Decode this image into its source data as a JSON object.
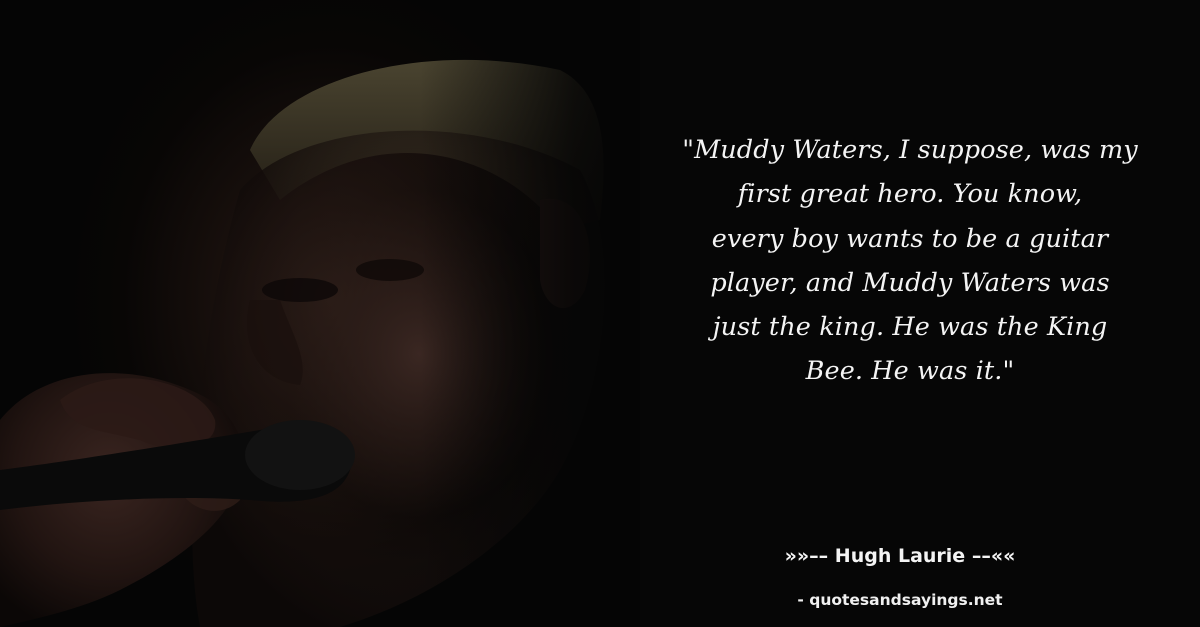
{
  "quote": {
    "lines": [
      "\"Muddy Waters, I suppose, was my",
      "first great hero. You know,",
      "every boy wants to be a guitar",
      "player, and Muddy Waters was",
      "just the king. He was the King",
      "Bee. He was it.\""
    ]
  },
  "attribution": {
    "left_ornament": "»»––",
    "author": "Hugh Laurie",
    "right_ornament": "––««"
  },
  "source": {
    "text": "- quotesandsayings.net"
  },
  "colors": {
    "background": "#060606",
    "text": "#f4f4f4"
  }
}
